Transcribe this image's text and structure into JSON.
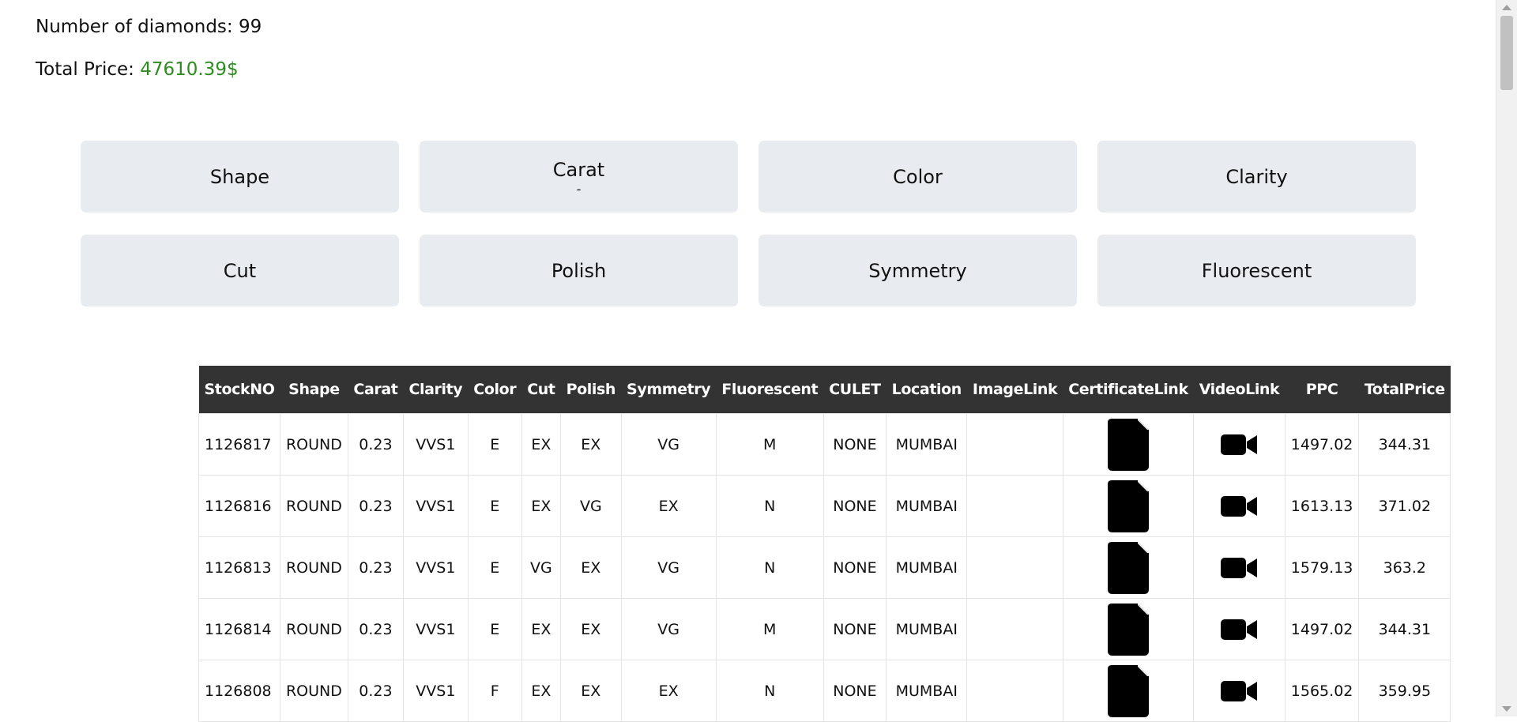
{
  "summary": {
    "count_label": "Number of diamonds: 99",
    "price_label": "Total Price: ",
    "price_value": "47610.39$"
  },
  "filters": [
    {
      "label": "Shape",
      "sub": ""
    },
    {
      "label": "Carat",
      "sub": "-"
    },
    {
      "label": "Color",
      "sub": ""
    },
    {
      "label": "Clarity",
      "sub": ""
    },
    {
      "label": "Cut",
      "sub": ""
    },
    {
      "label": "Polish",
      "sub": ""
    },
    {
      "label": "Symmetry",
      "sub": ""
    },
    {
      "label": "Fluorescent",
      "sub": ""
    }
  ],
  "table": {
    "columns": [
      "StockNO",
      "Shape",
      "Carat",
      "Clarity",
      "Color",
      "Cut",
      "Polish",
      "Symmetry",
      "Fluorescent",
      "CULET",
      "Location",
      "ImageLink",
      "CertificateLink",
      "VideoLink",
      "PPC",
      "TotalPrice"
    ],
    "rows": [
      {
        "stock": "1126817",
        "shape": "ROUND",
        "carat": "0.23",
        "clarity": "VVS1",
        "color": "E",
        "cut": "EX",
        "polish": "EX",
        "symmetry": "VG",
        "fluorescent": "M",
        "culet": "NONE",
        "location": "MUMBAI",
        "image": "",
        "ppc": "1497.02",
        "total": "344.31"
      },
      {
        "stock": "1126816",
        "shape": "ROUND",
        "carat": "0.23",
        "clarity": "VVS1",
        "color": "E",
        "cut": "EX",
        "polish": "VG",
        "symmetry": "EX",
        "fluorescent": "N",
        "culet": "NONE",
        "location": "MUMBAI",
        "image": "",
        "ppc": "1613.13",
        "total": "371.02"
      },
      {
        "stock": "1126813",
        "shape": "ROUND",
        "carat": "0.23",
        "clarity": "VVS1",
        "color": "E",
        "cut": "VG",
        "polish": "EX",
        "symmetry": "VG",
        "fluorescent": "N",
        "culet": "NONE",
        "location": "MUMBAI",
        "image": "",
        "ppc": "1579.13",
        "total": "363.2"
      },
      {
        "stock": "1126814",
        "shape": "ROUND",
        "carat": "0.23",
        "clarity": "VVS1",
        "color": "E",
        "cut": "EX",
        "polish": "EX",
        "symmetry": "VG",
        "fluorescent": "M",
        "culet": "NONE",
        "location": "MUMBAI",
        "image": "",
        "ppc": "1497.02",
        "total": "344.31"
      },
      {
        "stock": "1126808",
        "shape": "ROUND",
        "carat": "0.23",
        "clarity": "VVS1",
        "color": "F",
        "cut": "EX",
        "polish": "EX",
        "symmetry": "EX",
        "fluorescent": "N",
        "culet": "NONE",
        "location": "MUMBAI",
        "image": "",
        "ppc": "1565.02",
        "total": "359.95"
      }
    ],
    "certificate_icon": "file-icon",
    "video_icon": "video-camera-icon"
  },
  "colors": {
    "price": "#2e8b22",
    "header_bg": "#333333",
    "filter_bg": "#e8ecf0"
  }
}
